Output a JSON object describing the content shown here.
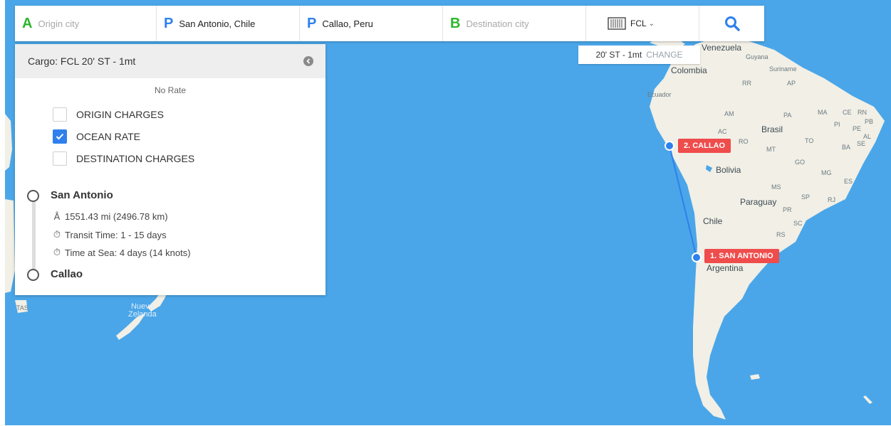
{
  "search": {
    "origin": {
      "letter": "A",
      "placeholder": "Origin city"
    },
    "origin_port": {
      "letter": "P",
      "value": "San Antonio, Chile"
    },
    "destination_port": {
      "letter": "P",
      "value": "Callao, Peru"
    },
    "destination": {
      "letter": "B",
      "placeholder": "Destination city"
    },
    "container_type": "FCL",
    "icons": {
      "container": "container-icon",
      "chevron": "chevron-down-icon",
      "search": "search-icon"
    }
  },
  "cargo_tag": {
    "label": "20' ST - 1mt",
    "action": "CHANGE"
  },
  "panel": {
    "header": "Cargo: FCL 20' ST - 1mt",
    "no_rate": "No Rate",
    "charges": [
      {
        "label": "ORIGIN CHARGES",
        "checked": false
      },
      {
        "label": "OCEAN RATE",
        "checked": true
      },
      {
        "label": "DESTINATION CHARGES",
        "checked": false
      }
    ],
    "route": {
      "origin": "San Antonio",
      "distance": "1551.43 mi (2496.78 km)",
      "transit_time": "Transit Time: 1 - 15 days",
      "time_at_sea": "Time at Sea: 4 days (14 knots)",
      "destination": "Callao"
    }
  },
  "map": {
    "markers": [
      {
        "label": "1. SAN ANTONIO"
      },
      {
        "label": "2. CALLAO"
      }
    ],
    "countries": [
      "Venezuela",
      "Guyana",
      "Suriname",
      "Colombia",
      "Ecuador",
      "Brasil",
      "Bolivia",
      "Paraguay",
      "Chile",
      "Argentina"
    ],
    "region_codes": [
      "RR",
      "AP",
      "AM",
      "PA",
      "MA",
      "CE",
      "RN",
      "PB",
      "PI",
      "PE",
      "AL",
      "AC",
      "RO",
      "MT",
      "TO",
      "BA",
      "SE",
      "GO",
      "MG",
      "ES",
      "MS",
      "SP",
      "RJ",
      "PR",
      "SC",
      "RS"
    ],
    "oceania": [
      "Nueva",
      "Zelanda",
      "TAS"
    ],
    "colors": {
      "sea": "#4aa6e8",
      "land": "#f1efe6",
      "route": "#2f80ed",
      "badge": "#ef4c4c"
    }
  }
}
